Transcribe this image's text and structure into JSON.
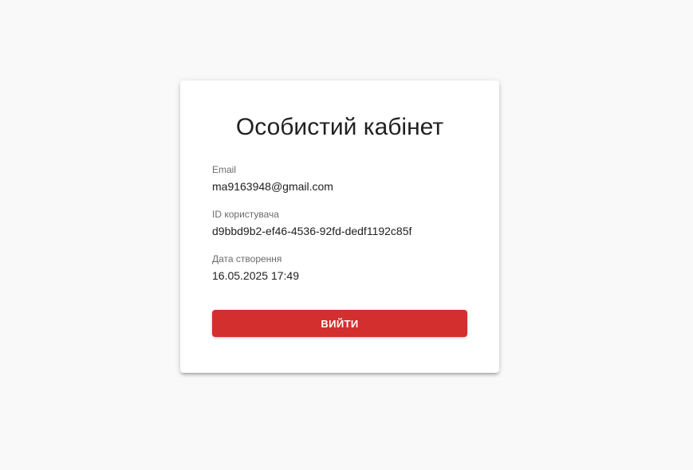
{
  "profile": {
    "title": "Особистий кабінет",
    "fields": [
      {
        "label": "Email",
        "value": "ma9163948@gmail.com"
      },
      {
        "label": "ID користувача",
        "value": "d9bbd9b2-ef46-4536-92fd-dedf1192c85f"
      },
      {
        "label": "Дата створення",
        "value": "16.05.2025 17:49"
      }
    ],
    "logout_label": "Вийти"
  },
  "colors": {
    "background": "#f9f9f9",
    "card": "#ffffff",
    "danger": "#d32f2f"
  }
}
